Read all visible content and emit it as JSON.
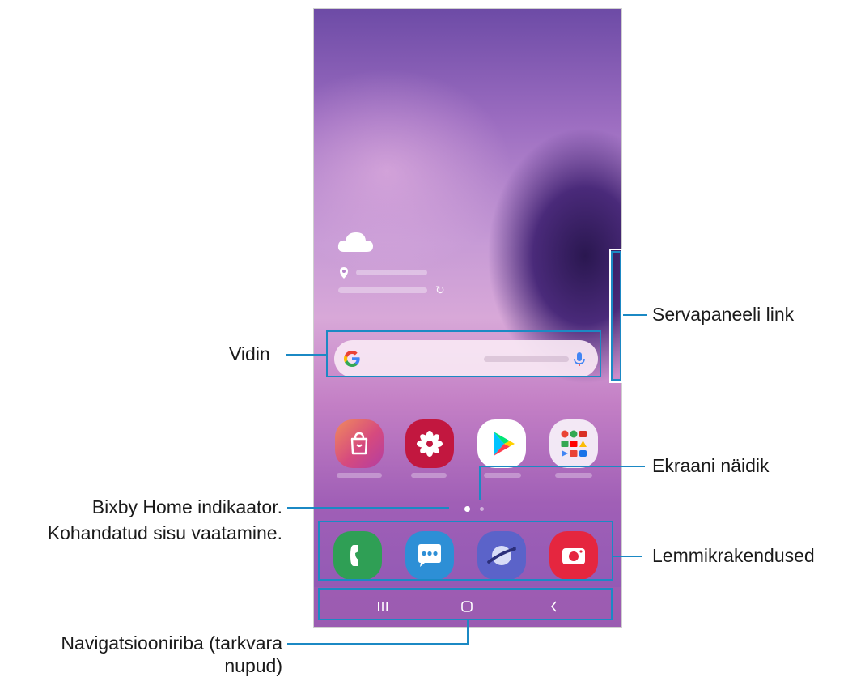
{
  "labels": {
    "vidin": "Vidin",
    "bixby_line1": "Bixby Home indikaator.",
    "bixby_line2": "Kohandatud sisu vaatamine.",
    "nav_line1": "Navigatsiooniriba (tarkvara",
    "nav_line2": "nupud)",
    "servapaneeli": "Servapaneeli link",
    "ekraani": "Ekraani näidik",
    "lemmik": "Lemmikrakendused"
  },
  "icons": {
    "weather": "cloud-icon",
    "location": "location-pin-icon",
    "refresh": "refresh-icon",
    "google": "google-g-icon",
    "mic": "microphone-icon",
    "galaxy_store": "shopping-bag-icon",
    "gallery": "flower-icon",
    "play_store": "play-triangle-icon",
    "google_folder": "app-folder-icon",
    "phone": "phone-handset-icon",
    "messages": "chat-bubble-icon",
    "internet": "planet-icon",
    "camera": "camera-icon",
    "recents": "recents-bars-icon",
    "home": "home-square-icon",
    "back": "back-chevron-icon"
  },
  "glyphs": {
    "refresh": "↻",
    "recents": "|||",
    "back": "‹"
  },
  "colors": {
    "callout": "#1b89c4",
    "galaxy_store": "#d64a7e",
    "gallery": "#c2173f",
    "play_store": "#ffffff",
    "phone": "#2f9f55",
    "messages": "#2d8fd6",
    "internet": "#5b63c9",
    "camera": "#e5263f"
  }
}
